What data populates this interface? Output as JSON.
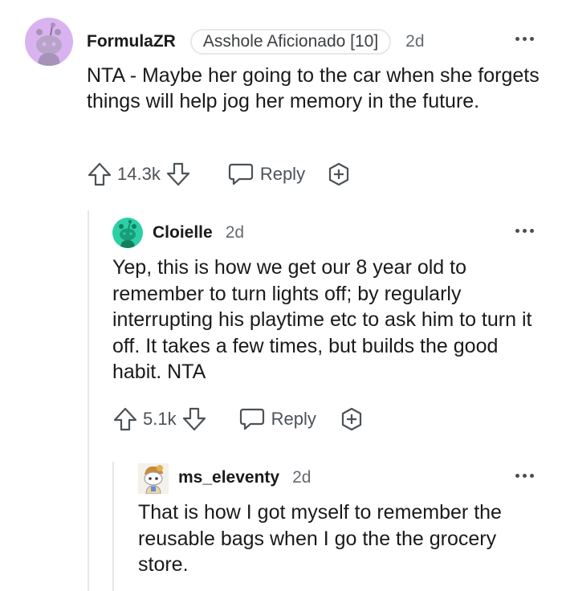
{
  "comments": [
    {
      "username": "FormulaZR",
      "flair": "Asshole Aficionado [10]",
      "time": "2d",
      "body": "NTA - Maybe her going to the car when she forgets things will help jog her memory in the future.",
      "votes": "14.3k",
      "reply_label": "Reply"
    },
    {
      "username": "Cloielle",
      "time": "2d",
      "body": "Yep, this is how we get our 8 year old to remember to turn lights off; by regularly interrupting his playtime etc to ask him to turn it off. It takes a few times, but builds the good habit. NTA",
      "votes": "5.1k",
      "reply_label": "Reply"
    },
    {
      "username": "ms_eleventy",
      "time": "2d",
      "body": "That is how I got myself to remember the reusable bags when I go the the grocery store."
    }
  ],
  "colors": {
    "avatar_purple": "#d9b3f0",
    "avatar_teal": "#2bcfa6",
    "text": "#1a1a1b",
    "meta": "#656b70",
    "thread_line": "#e4e6e7"
  }
}
